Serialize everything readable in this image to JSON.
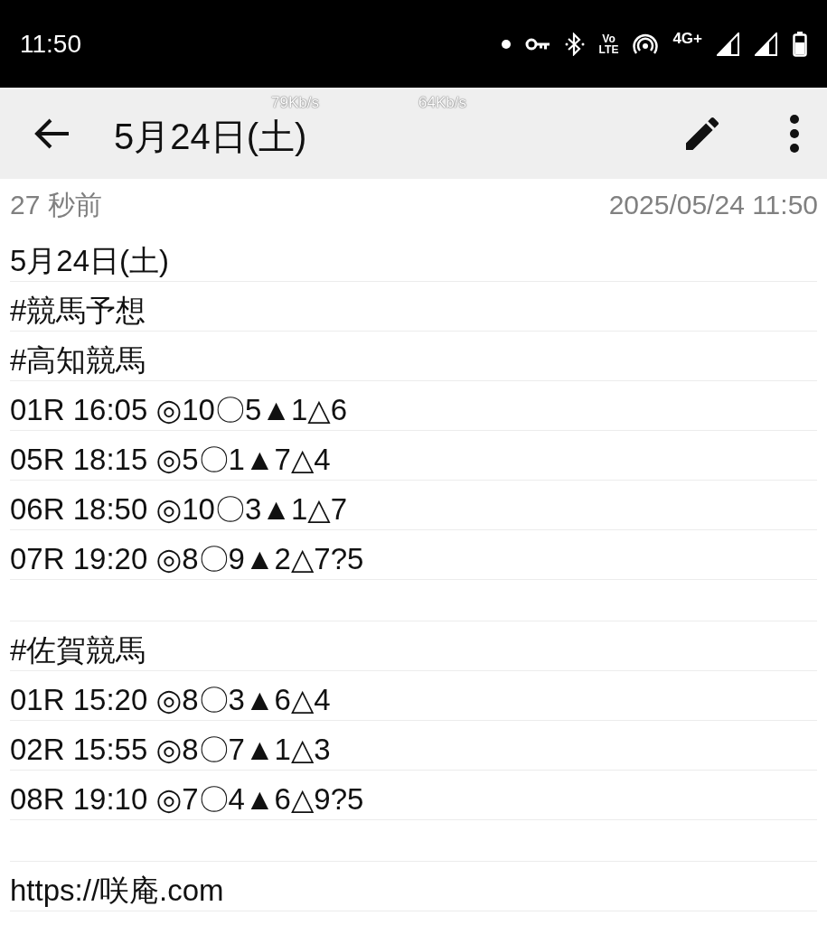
{
  "status_bar": {
    "time": "11:50",
    "volte_top": "Vo",
    "volte_bottom": "LTE",
    "network": "4G+"
  },
  "speed_overlays": [
    "79Kb/s",
    "64Kb/s"
  ],
  "toolbar": {
    "title": "5月24日(土)"
  },
  "meta": {
    "edited": "27 秒前",
    "datetime": "2025/05/24 11:50"
  },
  "note_lines": [
    {
      "kind": "text",
      "text": "5月24日(土)"
    },
    {
      "kind": "text",
      "text": "#競馬予想"
    },
    {
      "kind": "text",
      "text": "#高知競馬"
    },
    {
      "kind": "text",
      "text": "01R 16:05 ◎10〇5▲1△6"
    },
    {
      "kind": "text",
      "text": "05R 18:15 ◎5〇1▲7△4"
    },
    {
      "kind": "text",
      "text": "06R 18:50 ◎10〇3▲1△7"
    },
    {
      "kind": "text",
      "text": "07R 19:20 ◎8〇9▲2△7?5"
    },
    {
      "kind": "blank"
    },
    {
      "kind": "text",
      "text": "#佐賀競馬"
    },
    {
      "kind": "text",
      "text": "01R 15:20 ◎8〇3▲6△4"
    },
    {
      "kind": "text",
      "text": "02R 15:55 ◎8〇7▲1△3"
    },
    {
      "kind": "text",
      "text": "08R 19:10 ◎7〇4▲6△9?5"
    },
    {
      "kind": "blank"
    },
    {
      "kind": "text",
      "text": "https://咲庵.com"
    }
  ]
}
